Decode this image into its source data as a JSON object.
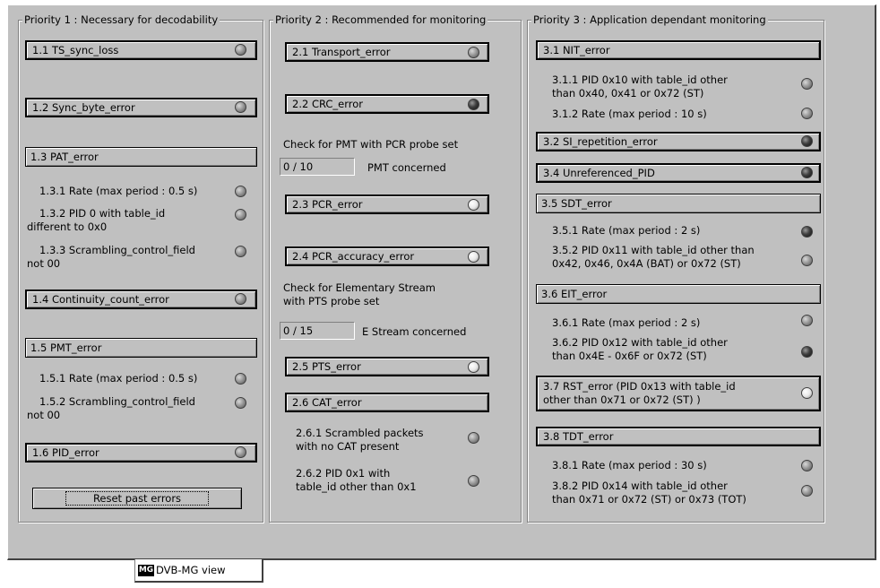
{
  "p1": {
    "title": "Priority 1 : Necessary for decodability",
    "e11": "1.1  TS_sync_loss",
    "e12": "1.2  Sync_byte_error",
    "e13": "1.3  PAT_error",
    "e131": "1.3.1  Rate (max period : 0.5 s)",
    "e132a": "1.3.2  PID 0 with table_id",
    "e132b": "different to 0x0",
    "e133a": "1.3.3  Scrambling_control_field",
    "e133b": "not 00",
    "e14": "1.4  Continuity_count_error",
    "e15": "1.5  PMT_error",
    "e151": "1.5.1  Rate (max period : 0.5 s)",
    "e152a": "1.5.2  Scrambling_control_field",
    "e152b": "not 00",
    "e16": "1.6  PID_error",
    "reset": "Reset past errors"
  },
  "p2": {
    "title": "Priority 2 : Recommended for monitoring",
    "e21": "2.1  Transport_error",
    "e22": "2.2  CRC_error",
    "pmt_check": "Check for PMT with PCR probe set",
    "pmt_count": "0 / 10",
    "pmt_label": "PMT concerned",
    "e23": "2.3  PCR_error",
    "e24": "2.4  PCR_accuracy_error",
    "es_check_a": "Check for Elementary Stream",
    "es_check_b": "with PTS probe set",
    "es_count": "0 / 15",
    "es_label": "E Stream concerned",
    "e25": "2.5  PTS_error",
    "e26": "2.6  CAT_error",
    "e261a": "2.6.1 Scrambled packets",
    "e261b": "with no CAT present",
    "e262a": "2.6.2  PID 0x1 with",
    "e262b": "table_id other than 0x1"
  },
  "p3": {
    "title": "Priority 3 : Application dependant monitoring",
    "e31": "3.1  NIT_error",
    "e311a": "3.1.1  PID 0x10 with table_id other",
    "e311b": "than 0x40, 0x41 or 0x72 (ST)",
    "e312": "3.1.2  Rate (max period : 10 s)",
    "e32": "3.2  SI_repetition_error",
    "e34": "3.4  Unreferenced_PID",
    "e35": "3.5  SDT_error",
    "e351": "3.5.1  Rate (max period : 2 s)",
    "e352a": "3.5.2  PID 0x11 with table_id other than",
    "e352b": "0x42, 0x46, 0x4A (BAT) or 0x72 (ST)",
    "e36": "3.6  EIT_error",
    "e361": "3.6.1  Rate (max period : 2 s)",
    "e362a": "3.6.2  PID 0x12 with table_id other",
    "e362b": "than 0x4E - 0x6F or 0x72 (ST)",
    "e37a": "3.7  RST_error (PID 0x13 with table_id",
    "e37b": "other than 0x71 or 0x72 (ST) )",
    "e38": "3.8  TDT_error",
    "e381": "3.8.1  Rate (max period : 30 s)",
    "e382a": "3.8.2  PID 0x14 with table_id other",
    "e382b": "than 0x71 or 0x72 (ST) or 0x73 (TOT)"
  },
  "tab": {
    "logo": "MG",
    "label": "DVB-MG view"
  }
}
